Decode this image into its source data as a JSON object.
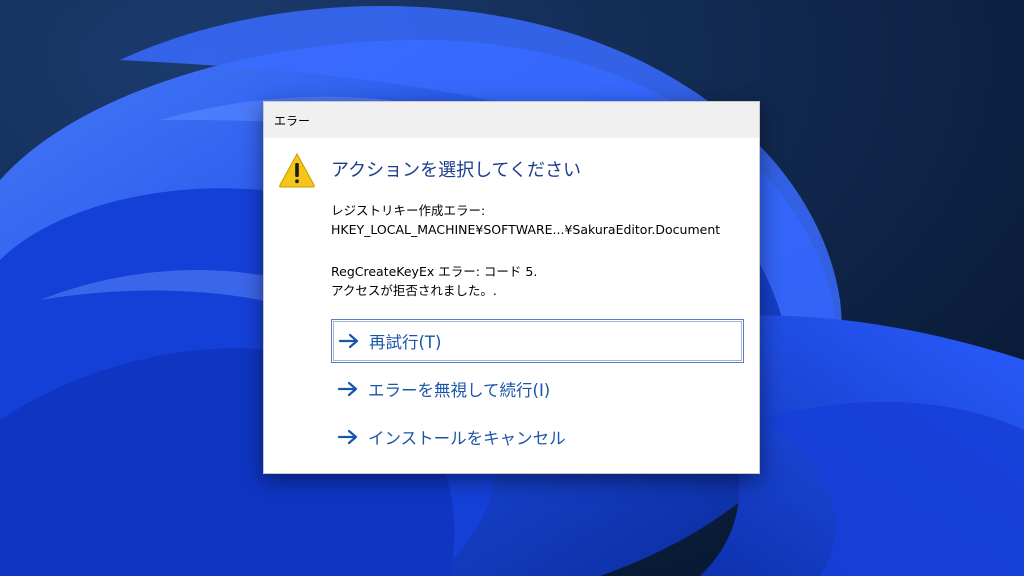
{
  "dialog": {
    "title": "エラー",
    "heading": "アクションを選択してください",
    "message_lines": [
      "レジストリキー作成エラー:",
      "HKEY_LOCAL_MACHINE¥SOFTWARE...¥SakuraEditor.Document",
      "RegCreateKeyEx エラー: コード 5.",
      "アクセスが拒否されました。."
    ],
    "icon": "warning-icon",
    "commands": [
      {
        "label": "再試行(T)",
        "focused": true
      },
      {
        "label": "エラーを無視して続行(I)",
        "focused": false
      },
      {
        "label": "インストールをキャンセル",
        "focused": false
      }
    ]
  },
  "colors": {
    "heading": "#1c3d8c",
    "command_link": "#1a55a8",
    "titlebar": "#f0f0f0",
    "wallpaper_base": "#0b1f3f",
    "wallpaper_accent": "#1d4ff0"
  }
}
